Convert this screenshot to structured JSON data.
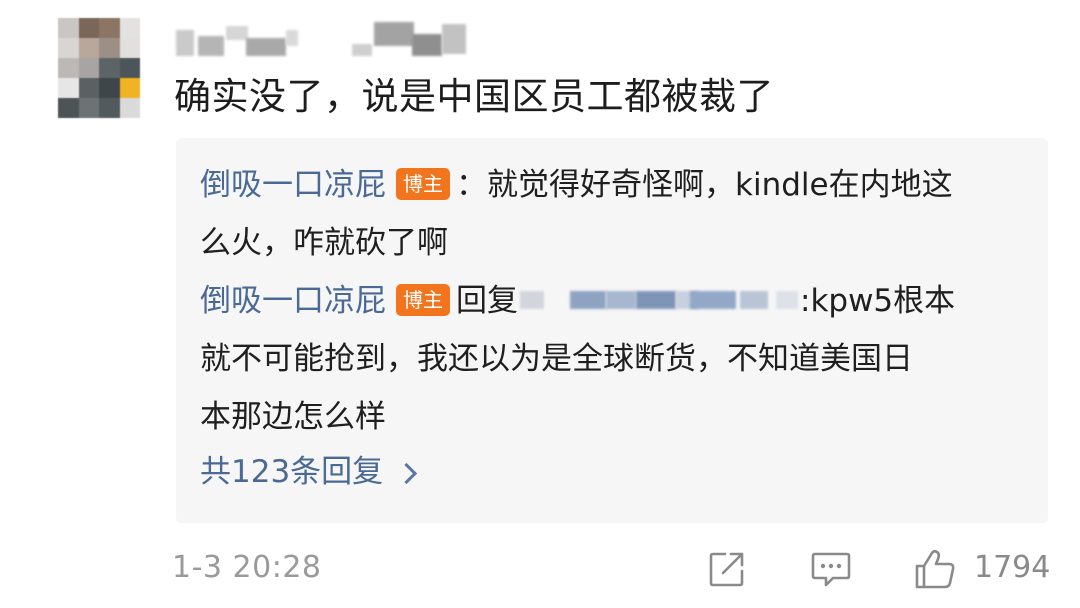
{
  "comment": {
    "text": "确实没了，说是中国区员工都被裁了",
    "timestamp": "1-3 20:28",
    "like_count": "1794"
  },
  "replies": [
    {
      "author": "倒吸一口凉屁",
      "badge": "博主",
      "line1": "：就觉得好奇怪啊，kindle在内地这",
      "line2": "么火，咋就砍了啊"
    },
    {
      "author": "倒吸一口凉屁",
      "badge": "博主",
      "reply_prefix": "回复",
      "line1_suffix": ":kpw5根本",
      "line2": "就不可能抢到，我还以为是全球断货，不知道美国日",
      "line3": "本那边怎么样"
    }
  ],
  "more_replies_label": "共123条回复",
  "icons": {
    "share": "share-icon",
    "comment": "comment-icon",
    "like": "thumbs-up-icon",
    "more": "chevron-right-icon"
  },
  "colors": {
    "author_link": "#4a6a95",
    "badge": "#f2751e",
    "reply_background": "#f6f6f7",
    "meta_text": "#9a9a9a"
  }
}
